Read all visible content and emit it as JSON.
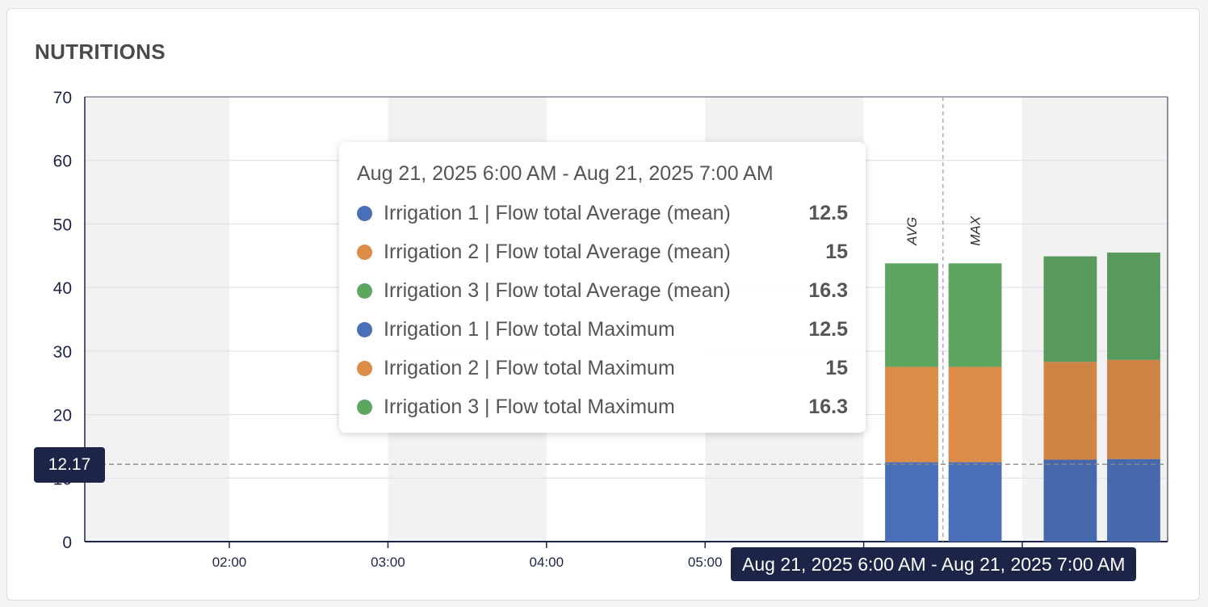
{
  "card": {
    "title": "NUTRITIONS"
  },
  "colors": {
    "series1": "#4a6fb8",
    "series2": "#dd8c48",
    "series3": "#5ea562",
    "series1_dim": "#4669ad",
    "series2_dim": "#cf8344",
    "series3_dim": "#579a5c",
    "band": "#f2f2f3",
    "crosshair_label_bg": "#1c2547"
  },
  "chart_data": {
    "type": "bar",
    "stacked": true,
    "ylim": [
      0,
      70
    ],
    "yticks": [
      0,
      10,
      20,
      30,
      40,
      50,
      60,
      70
    ],
    "xticks": [
      "02:00",
      "03:00",
      "04:00",
      "05:00"
    ],
    "grid": true,
    "groups": [
      {
        "period": "Aug 21, 2025 6:00 AM - Aug 21, 2025 7:00 AM",
        "bars": [
          {
            "label": "AVG",
            "stack": [
              12.5,
              15,
              16.3
            ]
          },
          {
            "label": "MAX",
            "stack": [
              12.5,
              15,
              16.3
            ]
          }
        ]
      },
      {
        "period": "",
        "bars": [
          {
            "label": "",
            "stack": [
              12.9,
              15.4,
              16.6
            ]
          },
          {
            "label": "",
            "stack": [
              13.0,
              15.6,
              16.9
            ]
          }
        ]
      }
    ]
  },
  "tooltip": {
    "header": "Aug 21, 2025 6:00 AM - Aug 21, 2025 7:00 AM",
    "rows": [
      {
        "label": "Irrigation 1 | Flow total Average (mean)",
        "value": "12.5",
        "color": "#4a6fb8"
      },
      {
        "label": "Irrigation 2 | Flow total Average (mean)",
        "value": "15",
        "color": "#dd8c48"
      },
      {
        "label": "Irrigation 3 | Flow total Average (mean)",
        "value": "16.3",
        "color": "#5ea562"
      },
      {
        "label": "Irrigation 1 | Flow total Maximum",
        "value": "12.5",
        "color": "#4a6fb8"
      },
      {
        "label": "Irrigation 2 | Flow total Maximum",
        "value": "15",
        "color": "#dd8c48"
      },
      {
        "label": "Irrigation 3 | Flow total Maximum",
        "value": "16.3",
        "color": "#5ea562"
      }
    ]
  },
  "crosshair": {
    "x_label": "Aug 21, 2025 6:00 AM - Aug 21, 2025 7:00 AM",
    "y_label": "12.17",
    "y_value": 12.17
  }
}
